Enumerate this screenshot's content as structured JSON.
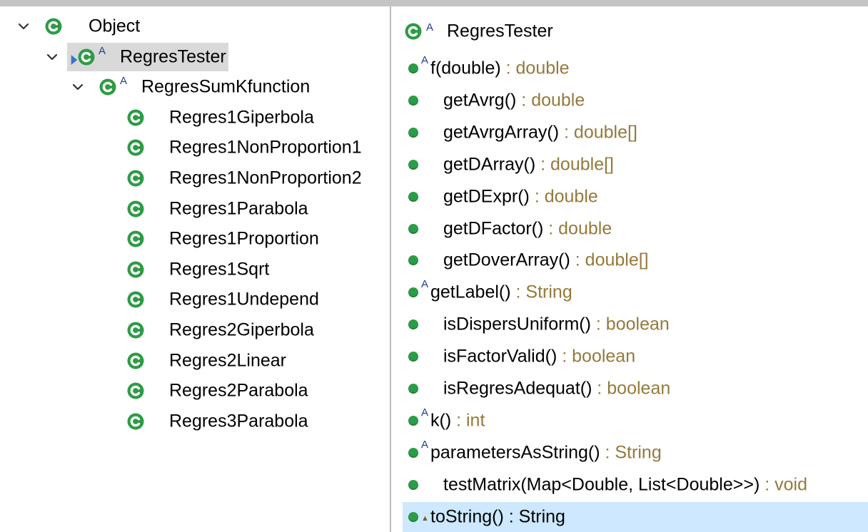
{
  "tree": {
    "items": [
      {
        "label": "Object",
        "level": 0,
        "expanded": true,
        "abstract": false,
        "selected": false
      },
      {
        "label": "RegresTester",
        "level": 1,
        "expanded": true,
        "abstract": true,
        "selected": true
      },
      {
        "label": "RegresSumKfunction",
        "level": 2,
        "expanded": true,
        "abstract": true,
        "selected": false
      },
      {
        "label": "Regres1Giperbola",
        "level": 3,
        "expanded": false,
        "abstract": false,
        "selected": false
      },
      {
        "label": "Regres1NonProportion1",
        "level": 3,
        "expanded": false,
        "abstract": false,
        "selected": false
      },
      {
        "label": "Regres1NonProportion2",
        "level": 3,
        "expanded": false,
        "abstract": false,
        "selected": false
      },
      {
        "label": "Regres1Parabola",
        "level": 3,
        "expanded": false,
        "abstract": false,
        "selected": false
      },
      {
        "label": "Regres1Proportion",
        "level": 3,
        "expanded": false,
        "abstract": false,
        "selected": false
      },
      {
        "label": "Regres1Sqrt",
        "level": 3,
        "expanded": false,
        "abstract": false,
        "selected": false
      },
      {
        "label": "Regres1Undepend",
        "level": 3,
        "expanded": false,
        "abstract": false,
        "selected": false
      },
      {
        "label": "Regres2Giperbola",
        "level": 3,
        "expanded": false,
        "abstract": false,
        "selected": false
      },
      {
        "label": "Regres2Linear",
        "level": 3,
        "expanded": false,
        "abstract": false,
        "selected": false
      },
      {
        "label": "Regres2Parabola",
        "level": 3,
        "expanded": false,
        "abstract": false,
        "selected": false
      },
      {
        "label": "Regres3Parabola",
        "level": 3,
        "expanded": false,
        "abstract": false,
        "selected": false
      }
    ]
  },
  "members": {
    "header_title": "RegresTester",
    "items": [
      {
        "name": "f(double)",
        "type": " : double",
        "modifier": "abstract",
        "selected": false
      },
      {
        "name": "getAvrg()",
        "type": " : double",
        "modifier": "",
        "selected": false
      },
      {
        "name": "getAvrgArray()",
        "type": " : double[]",
        "modifier": "",
        "selected": false
      },
      {
        "name": "getDArray()",
        "type": " : double[]",
        "modifier": "",
        "selected": false
      },
      {
        "name": "getDExpr()",
        "type": " : double",
        "modifier": "",
        "selected": false
      },
      {
        "name": "getDFactor()",
        "type": " : double",
        "modifier": "",
        "selected": false
      },
      {
        "name": "getDoverArray()",
        "type": " : double[]",
        "modifier": "",
        "selected": false
      },
      {
        "name": "getLabel()",
        "type": " : String",
        "modifier": "abstract",
        "selected": false
      },
      {
        "name": "isDispersUniform()",
        "type": " : boolean",
        "modifier": "",
        "selected": false
      },
      {
        "name": "isFactorValid()",
        "type": " : boolean",
        "modifier": "",
        "selected": false
      },
      {
        "name": "isRegresAdequat()",
        "type": " : boolean",
        "modifier": "",
        "selected": false
      },
      {
        "name": "k()",
        "type": " : int",
        "modifier": "abstract",
        "selected": false
      },
      {
        "name": "parametersAsString()",
        "type": " : String",
        "modifier": "abstract",
        "selected": false
      },
      {
        "name": "testMatrix(Map<Double, List<Double>>)",
        "type": " : void",
        "modifier": "",
        "selected": false
      },
      {
        "name": "toString()",
        "type": " : String",
        "modifier": "override",
        "selected": true
      }
    ]
  },
  "icons": {
    "class": "class-icon",
    "method": "public-method-icon",
    "chevron": "chevron-down-icon",
    "inherited": "inherited-arrow-icon"
  },
  "colors": {
    "class_icon_green": "#2e9b46",
    "abstract_marker_blue": "#1e3f8a",
    "return_type": "#96793a",
    "selection_tree": "#d9d9d9",
    "selection_member": "#cde8ff"
  }
}
